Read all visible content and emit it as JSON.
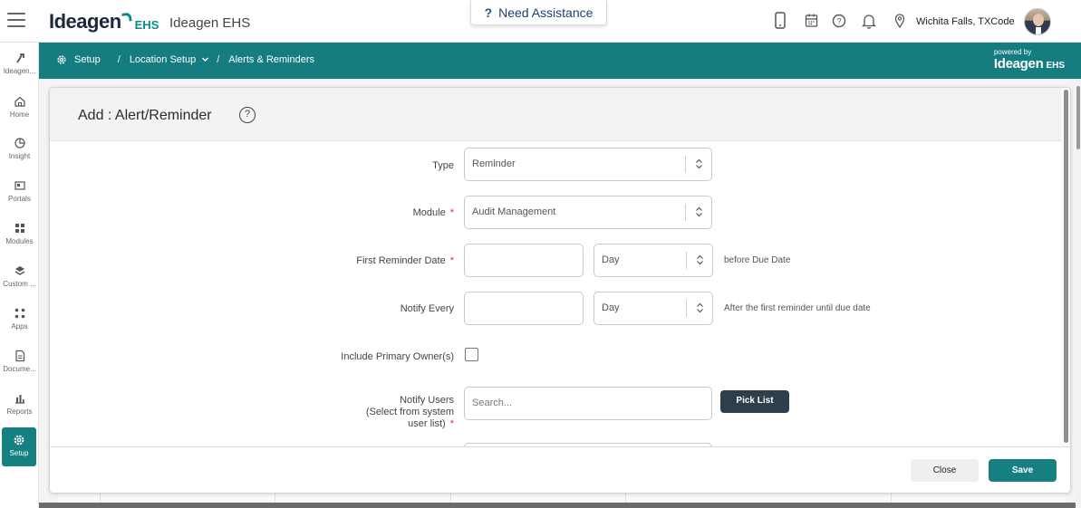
{
  "topbar": {
    "logo_text": "Ideagen",
    "logo_sub": "EHS",
    "app_title": "Ideagen EHS",
    "assist_icon": "?",
    "assist_label": "Need Assistance",
    "location": "Wichita Falls, TXCode"
  },
  "sidebar": {
    "items": [
      {
        "label": "Ideagen...",
        "icon": "ideagen-icon"
      },
      {
        "label": "Home",
        "icon": "home-icon"
      },
      {
        "label": "Insight",
        "icon": "pie-chart-icon"
      },
      {
        "label": "Portals",
        "icon": "portal-icon"
      },
      {
        "label": "Modules",
        "icon": "grid-icon"
      },
      {
        "label": "Custom ...",
        "icon": "layers-icon"
      },
      {
        "label": "Apps",
        "icon": "apps-icon"
      },
      {
        "label": "Docume...",
        "icon": "document-icon"
      },
      {
        "label": "Reports",
        "icon": "bar-chart-icon"
      },
      {
        "label": "Setup",
        "icon": "gear-icon"
      }
    ]
  },
  "breadcrumb": {
    "items": [
      "Setup",
      "Location Setup",
      "Alerts & Reminders"
    ],
    "separator": "/",
    "powered_by": "powered by",
    "powered_logo": "Ideagen",
    "powered_sub": "EHS"
  },
  "modal": {
    "title": "Add : Alert/Reminder",
    "help": "?",
    "fields": {
      "type_label": "Type",
      "type_value": "Reminder",
      "module_label": "Module",
      "module_value": "Audit Management",
      "first_reminder_label": "First Reminder Date",
      "first_reminder_value": "",
      "first_reminder_unit": "Day",
      "first_reminder_after": "before Due Date",
      "notify_every_label": "Notify Every",
      "notify_every_value": "",
      "notify_every_unit": "Day",
      "notify_every_after": "After the first reminder until due date",
      "include_owner_label": "Include Primary Owner(s)",
      "notify_users_label_1": "Notify Users",
      "notify_users_label_2": "(Select from system",
      "notify_users_label_3": "user list)",
      "notify_users_placeholder": "Search...",
      "pick_list": "Pick List",
      "required_mark": "*"
    },
    "footer": {
      "close": "Close",
      "save": "Save"
    }
  }
}
